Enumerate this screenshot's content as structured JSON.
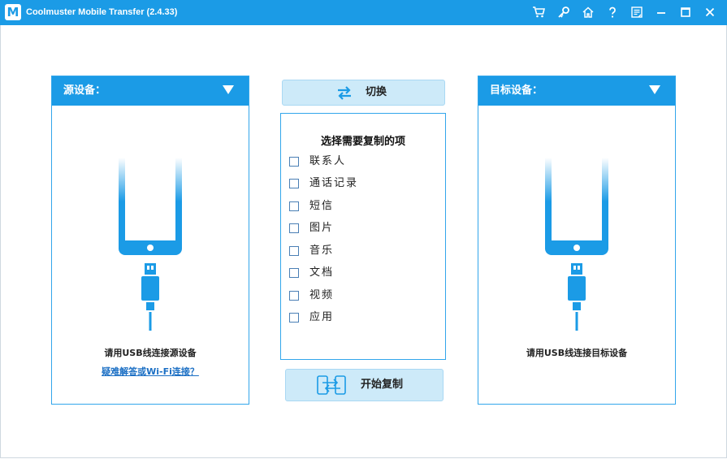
{
  "app": {
    "logo_letter": "M",
    "title": "Coolmuster Mobile Transfer  (2.4.33)"
  },
  "toolbar": {
    "icons": [
      "cart-icon",
      "key-icon",
      "home-icon",
      "help-icon",
      "feedback-icon",
      "minimize-icon",
      "maximize-icon",
      "close-icon"
    ]
  },
  "source_panel": {
    "title": "源设备：",
    "connect_text": "请用USB线连接源设备",
    "help_link": "疑难解答或Wi-Fi连接？"
  },
  "target_panel": {
    "title": "目标设备：",
    "connect_text": "请用USB线连接目标设备"
  },
  "switch_button": {
    "label": "切换"
  },
  "selection": {
    "title": "选择需要复制的项",
    "options": [
      {
        "label": "联系人",
        "checked": false
      },
      {
        "label": "通话记录",
        "checked": false
      },
      {
        "label": "短信",
        "checked": false
      },
      {
        "label": "图片",
        "checked": false
      },
      {
        "label": "音乐",
        "checked": false
      },
      {
        "label": "文档",
        "checked": false
      },
      {
        "label": "视频",
        "checked": false
      },
      {
        "label": "应用",
        "checked": false
      }
    ]
  },
  "copy_button": {
    "label": "开始复制"
  },
  "colors": {
    "accent": "#1b9be6",
    "button_bg": "#cdeaf9",
    "link": "#1b6fc4"
  }
}
